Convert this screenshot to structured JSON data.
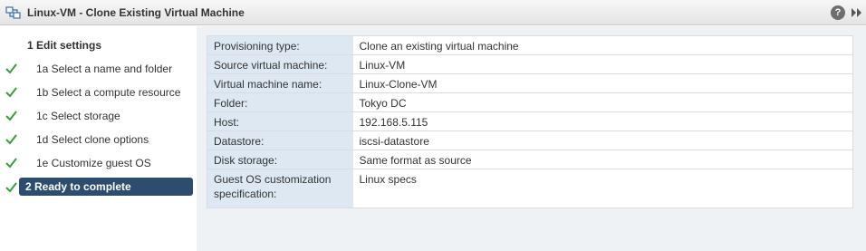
{
  "window": {
    "title": "Linux-VM - Clone Existing Virtual Machine",
    "help_label": "?"
  },
  "steps": [
    {
      "label": "1  Edit settings",
      "completed": false,
      "active": false,
      "level": "header"
    },
    {
      "label": "1a  Select a name and folder",
      "completed": true,
      "active": false,
      "level": "sub"
    },
    {
      "label": "1b  Select a compute resource",
      "completed": true,
      "active": false,
      "level": "sub"
    },
    {
      "label": "1c  Select storage",
      "completed": true,
      "active": false,
      "level": "sub"
    },
    {
      "label": "1d  Select clone options",
      "completed": true,
      "active": false,
      "level": "sub"
    },
    {
      "label": "1e  Customize guest OS",
      "completed": true,
      "active": false,
      "level": "sub"
    },
    {
      "label": "2  Ready to complete",
      "completed": true,
      "active": true,
      "level": "header"
    }
  ],
  "summary": [
    {
      "key": "Provisioning type:",
      "value": "Clone an existing virtual machine"
    },
    {
      "key": "Source virtual machine:",
      "value": "Linux-VM"
    },
    {
      "key": "Virtual machine name:",
      "value": "Linux-Clone-VM"
    },
    {
      "key": "Folder:",
      "value": "Tokyo DC"
    },
    {
      "key": "Host:",
      "value": "192.168.5.115"
    },
    {
      "key": "Datastore:",
      "value": "iscsi-datastore"
    },
    {
      "key": "Disk storage:",
      "value": "Same format as source"
    },
    {
      "key": "Guest OS customization specification:",
      "value": "Linux specs"
    }
  ],
  "colors": {
    "check": "#3c9b3c",
    "active_bg": "#2d4d6f",
    "key_bg": "#dde8f3",
    "content_bg": "#eef2f5"
  },
  "icons": [
    "vm-clone-icon",
    "help-icon",
    "expand-icon",
    "checkmark-icon"
  ]
}
